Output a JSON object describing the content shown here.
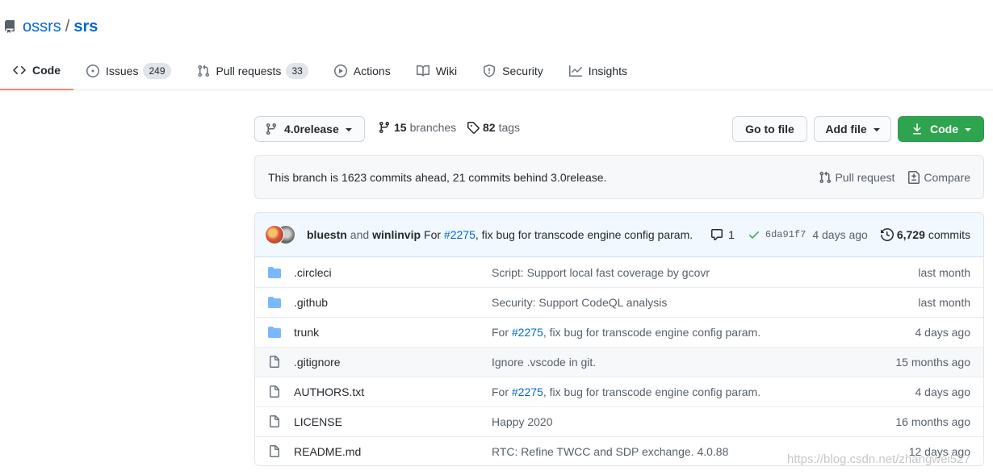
{
  "repo": {
    "owner": "ossrs",
    "separator": "/",
    "name": "srs"
  },
  "tabs": [
    {
      "label": "Code",
      "icon": "code-icon",
      "selected": true
    },
    {
      "label": "Issues",
      "count": "249",
      "icon": "issue-icon"
    },
    {
      "label": "Pull requests",
      "count": "33",
      "icon": "pull-request-icon"
    },
    {
      "label": "Actions",
      "icon": "play-icon"
    },
    {
      "label": "Wiki",
      "icon": "book-icon"
    },
    {
      "label": "Security",
      "icon": "shield-icon"
    },
    {
      "label": "Insights",
      "icon": "graph-icon"
    }
  ],
  "branch_bar": {
    "branch": "4.0release",
    "branches_count": "15",
    "branches_label": "branches",
    "tags_count": "82",
    "tags_label": "tags",
    "go_to_file": "Go to file",
    "add_file": "Add file",
    "code": "Code"
  },
  "branch_info": {
    "text": "This branch is 1623 commits ahead, 21 commits behind 3.0release.",
    "pull_request": "Pull request",
    "compare": "Compare"
  },
  "last_commit": {
    "author1": "bluestn",
    "and": "and",
    "author2": "winlinvip",
    "message_prefix": "For",
    "issue": "#2275",
    "message_suffix": ", fix bug for transcode engine config param.",
    "comments": "1",
    "sha": "6da91f7",
    "age": "4 days ago",
    "commits_count": "6,729",
    "commits_label": "commits"
  },
  "files": [
    {
      "type": "dir",
      "name": ".circleci",
      "msg": "Script: Support local fast coverage by gcovr",
      "age": "last month"
    },
    {
      "type": "dir",
      "name": ".github",
      "msg": "Security: Support CodeQL analysis",
      "age": "last month"
    },
    {
      "type": "dir",
      "name": "trunk",
      "msg_prefix": "For ",
      "issue": "#2275",
      "msg_suffix": ", fix bug for transcode engine config param.",
      "age": "4 days ago"
    },
    {
      "type": "file",
      "name": ".gitignore",
      "msg": "Ignore .vscode in git.",
      "age": "15 months ago",
      "hover": true
    },
    {
      "type": "file",
      "name": "AUTHORS.txt",
      "msg_prefix": "For ",
      "issue": "#2275",
      "msg_suffix": ", fix bug for transcode engine config param.",
      "age": "4 days ago"
    },
    {
      "type": "file",
      "name": "LICENSE",
      "msg": "Happy 2020",
      "age": "16 months ago"
    },
    {
      "type": "file",
      "name": "README.md",
      "msg": "RTC: Refine TWCC and SDP exchange. 4.0.88",
      "age": "12 days ago"
    }
  ],
  "watermark": "https://blog.csdn.net/zhangwei527",
  "colors": {
    "link": "#0366d6",
    "tab_underline": "#f9826c",
    "code_button": "#2ea44f",
    "folder": "#79b8ff",
    "commit_bar": "#f1f8ff"
  }
}
